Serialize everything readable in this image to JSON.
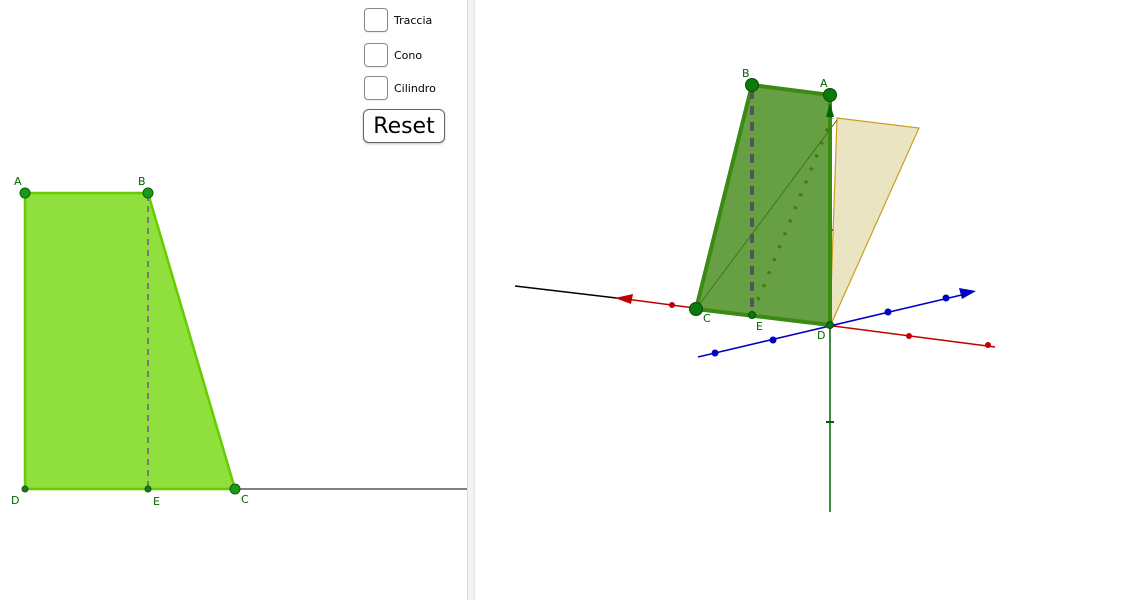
{
  "controls": {
    "checkboxes": [
      {
        "label": "Traccia",
        "checked": false
      },
      {
        "label": "Cono",
        "checked": false
      },
      {
        "label": "Cilindro",
        "checked": false
      }
    ],
    "reset_label": "Reset"
  },
  "view2d": {
    "points": {
      "A": "A",
      "B": "B",
      "C": "C",
      "D": "D",
      "E": "E"
    }
  },
  "view3d": {
    "points": {
      "A": "A",
      "B": "B",
      "C": "C",
      "D": "D",
      "E": "E"
    }
  },
  "colors": {
    "polygon_fill": "#8fe03c",
    "polygon_stroke": "#66cc00",
    "point": "#0a8a0a",
    "solid_fill": "#5f9a3a",
    "plane_fill": "#e8dfb8",
    "axis_x": "#c00000",
    "axis_y": "#0000c0",
    "axis_z": "#006400"
  }
}
